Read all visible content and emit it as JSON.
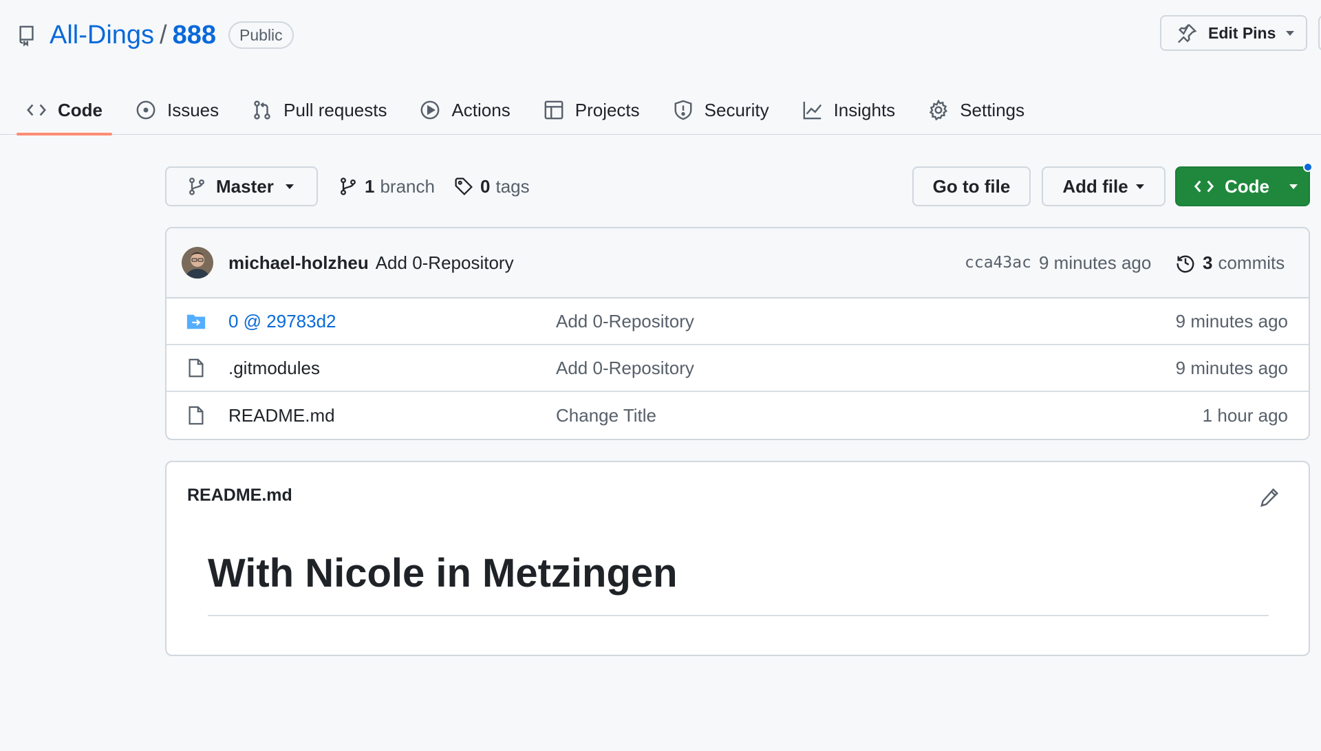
{
  "repo": {
    "owner": "All-Dings",
    "separator": "/",
    "name": "888",
    "visibility": "Public",
    "edit_pins_label": "Edit Pins"
  },
  "tabs": [
    {
      "label": "Code",
      "icon": "code-icon",
      "selected": true
    },
    {
      "label": "Issues",
      "icon": "issue-icon"
    },
    {
      "label": "Pull requests",
      "icon": "pull-request-icon"
    },
    {
      "label": "Actions",
      "icon": "play-icon"
    },
    {
      "label": "Projects",
      "icon": "table-icon"
    },
    {
      "label": "Security",
      "icon": "shield-icon"
    },
    {
      "label": "Insights",
      "icon": "graph-icon"
    },
    {
      "label": "Settings",
      "icon": "gear-icon"
    }
  ],
  "toolbar": {
    "branch_name": "Master",
    "branch_count": "1",
    "branch_label": "branch",
    "tag_count": "0",
    "tag_label": "tags",
    "go_to_file": "Go to file",
    "add_file": "Add file",
    "code": "Code"
  },
  "latest_commit": {
    "author": "michael-holzheu",
    "message": "Add 0-Repository",
    "sha": "cca43ac",
    "time": "9 minutes ago",
    "commit_count": "3",
    "commit_label": "commits"
  },
  "files": [
    {
      "name": "0 @ 29783d2",
      "type": "submodule",
      "message": "Add 0-Repository",
      "age": "9 minutes ago"
    },
    {
      "name": ".gitmodules",
      "type": "file",
      "message": "Add 0-Repository",
      "age": "9 minutes ago"
    },
    {
      "name": "README.md",
      "type": "file",
      "message": "Change Title",
      "age": "1 hour ago"
    }
  ],
  "readme": {
    "filename": "README.md",
    "heading": "With Nicole in Metzingen"
  },
  "colors": {
    "accent_link": "#0969da",
    "primary_button": "#1f883d",
    "selected_tab_underline": "#fd8c73"
  }
}
